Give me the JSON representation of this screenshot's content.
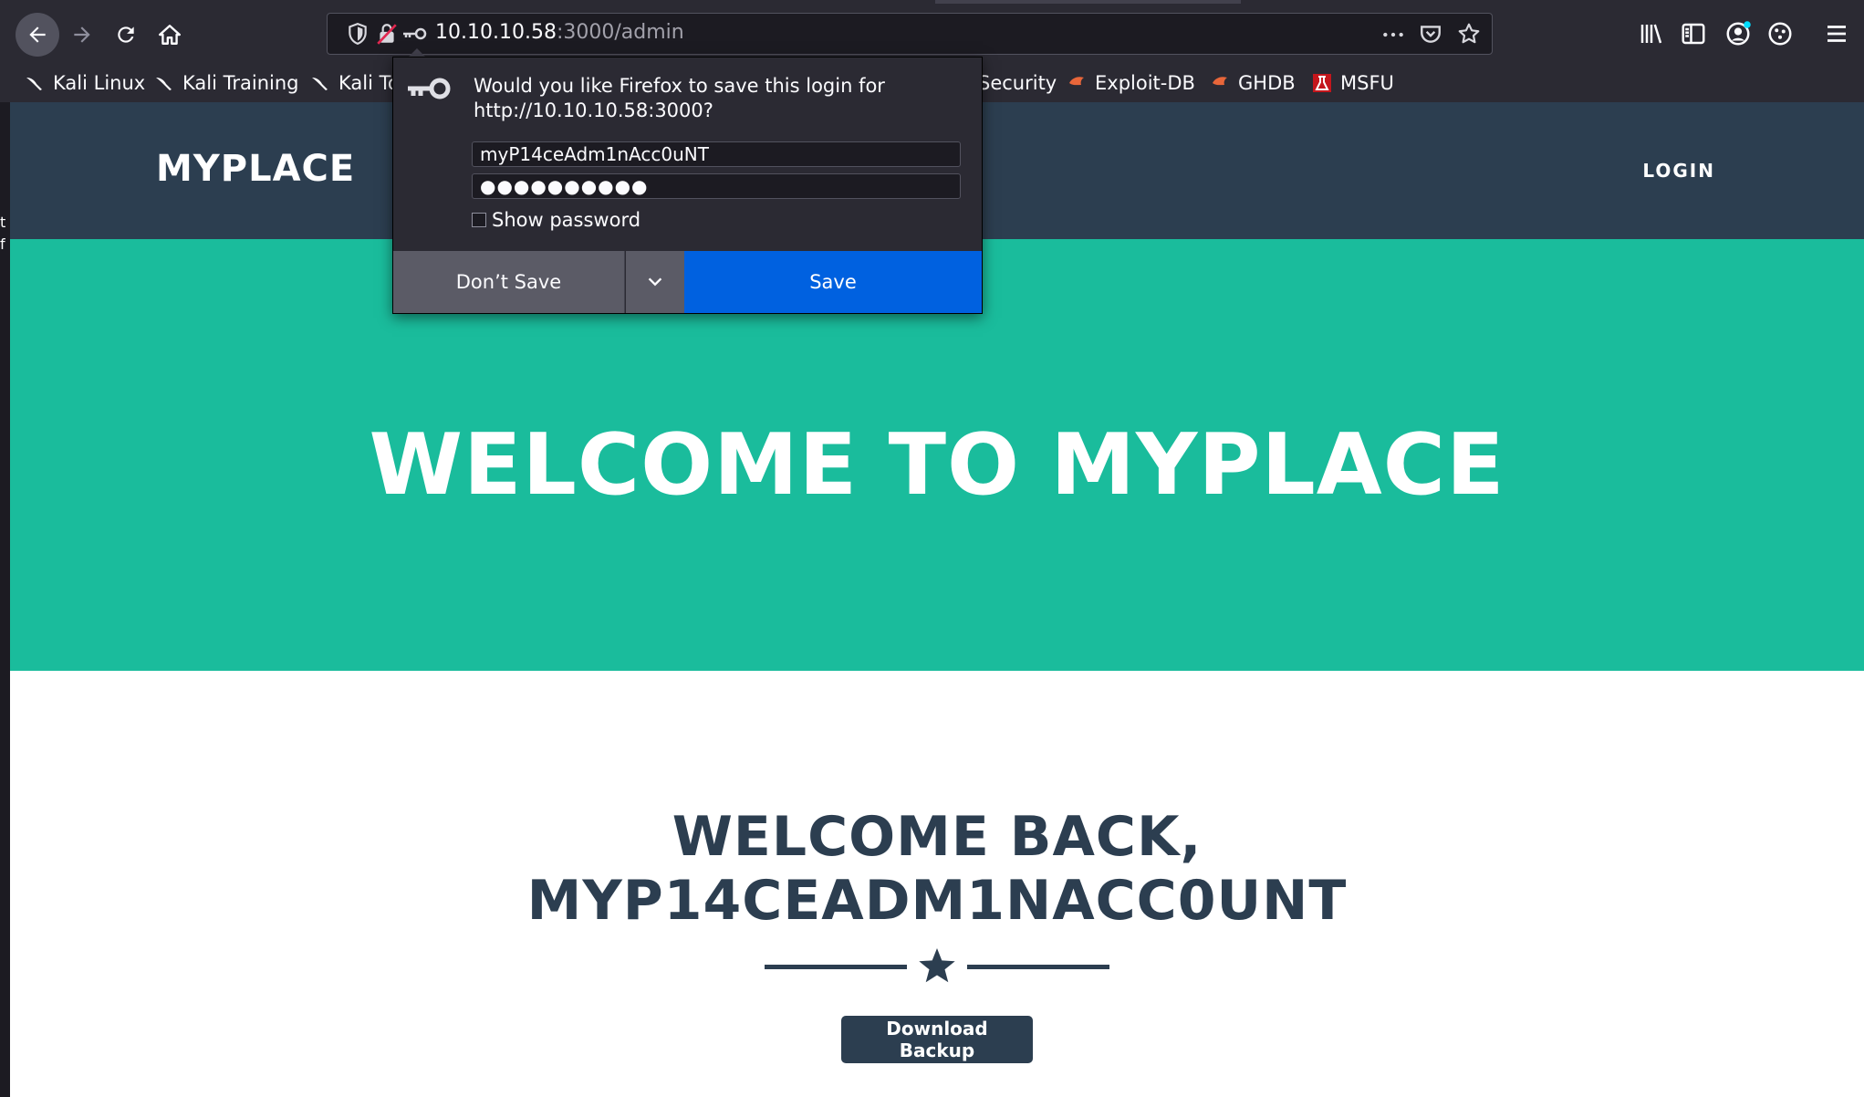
{
  "browser": {
    "url_host": "10.10.10.58",
    "url_path": ":3000/admin",
    "bookmarks": [
      {
        "label": "Kali Linux",
        "icon": "kali-dragon-icon"
      },
      {
        "label": "Kali Training",
        "icon": "kali-dragon-icon"
      },
      {
        "label": "Kali To",
        "icon": "kali-dragon-icon"
      },
      {
        "label": "Security",
        "icon": "none"
      },
      {
        "label": "Exploit-DB",
        "icon": "exploitdb-icon"
      },
      {
        "label": "GHDB",
        "icon": "ghdb-icon"
      },
      {
        "label": "MSFU",
        "icon": "msfu-icon"
      }
    ]
  },
  "popup": {
    "message": "Would you like Firefox to save this login for http://10.10.10.58:3000?",
    "username": "myP14ceAdm1nAcc0uNT",
    "password_mask": "●●●●●●●●●●",
    "show_password_label": "Show password",
    "dont_save_label": "Don’t Save",
    "save_label": "Save"
  },
  "site": {
    "brand": "MYPLACE",
    "nav_login": "LOGIN",
    "masthead_title": "WELCOME TO MYPLACE",
    "welcome_line1": "WELCOME BACK,",
    "welcome_line2": "MYP14CEADM1NACC0UNT",
    "download_label": "Download Backup"
  },
  "left_strip_text": "t f",
  "colors": {
    "nav_bg": "#2c3e50",
    "masthead_bg": "#1abc9c",
    "save_blue": "#0061e0"
  }
}
